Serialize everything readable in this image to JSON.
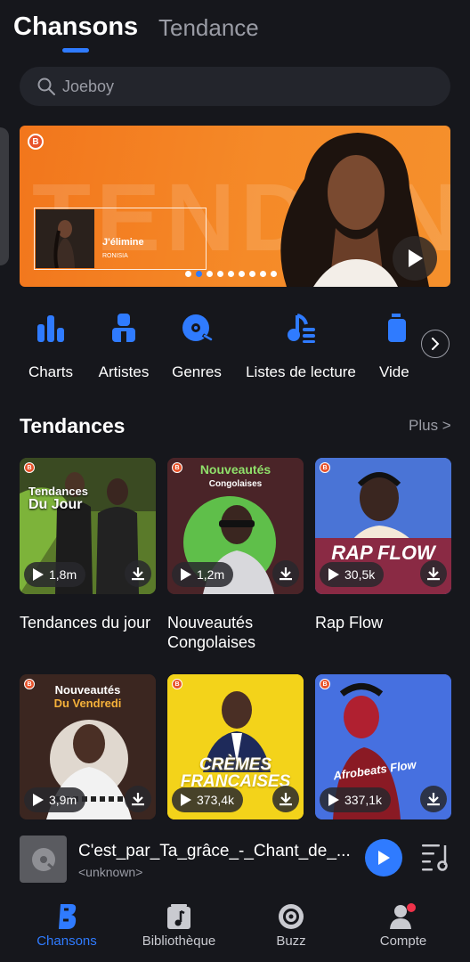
{
  "header": {
    "tab_active": "Chansons",
    "tab_other": "Tendance"
  },
  "search": {
    "placeholder": "Joeboy"
  },
  "banner": {
    "bg_text": "TENDANCE",
    "song": "J'élimine",
    "artist": "RONISIA",
    "slides": 9,
    "active_slide": 2,
    "badge": "B"
  },
  "categories": [
    {
      "label": "Charts",
      "icon": "charts-icon"
    },
    {
      "label": "Artistes",
      "icon": "artists-icon"
    },
    {
      "label": "Genres",
      "icon": "genres-icon"
    },
    {
      "label": "Listes de lecture",
      "icon": "playlists-icon"
    },
    {
      "label": "Vide",
      "icon": "videos-icon"
    }
  ],
  "section": {
    "title": "Tendances",
    "more": "Plus >"
  },
  "cards": [
    {
      "title": "Tendances du jour",
      "plays": "1,8m",
      "art_line1": "Tendances",
      "art_line2": "Du Jour"
    },
    {
      "title": "Nouveautés Congolaises",
      "plays": "1,2m",
      "art_line1": "Nouveautés",
      "art_line2": "Congolaises"
    },
    {
      "title": "Rap Flow",
      "plays": "30,5k",
      "art_line1": "RAP FLOW"
    },
    {
      "plays": "3,9m",
      "art_line1": "Nouveautés",
      "art_line2": "Du Vendredi"
    },
    {
      "plays": "373,4k",
      "art_line1": "CRÈMES",
      "art_line2": "FRANCAISES"
    },
    {
      "plays": "337,1k",
      "art_line1": "Afrobeats Flow"
    }
  ],
  "player": {
    "title": "C'est_par_Ta_grâce_-_Chant_de_...",
    "subtitle": "<unknown>"
  },
  "nav": [
    {
      "label": "Chansons",
      "icon": "songs-icon",
      "active": true
    },
    {
      "label": "Bibliothèque",
      "icon": "library-icon"
    },
    {
      "label": "Buzz",
      "icon": "buzz-icon"
    },
    {
      "label": "Compte",
      "icon": "account-icon"
    }
  ],
  "colors": {
    "accent": "#2f7bff",
    "background": "#16171c",
    "banner": "#f5842a"
  }
}
